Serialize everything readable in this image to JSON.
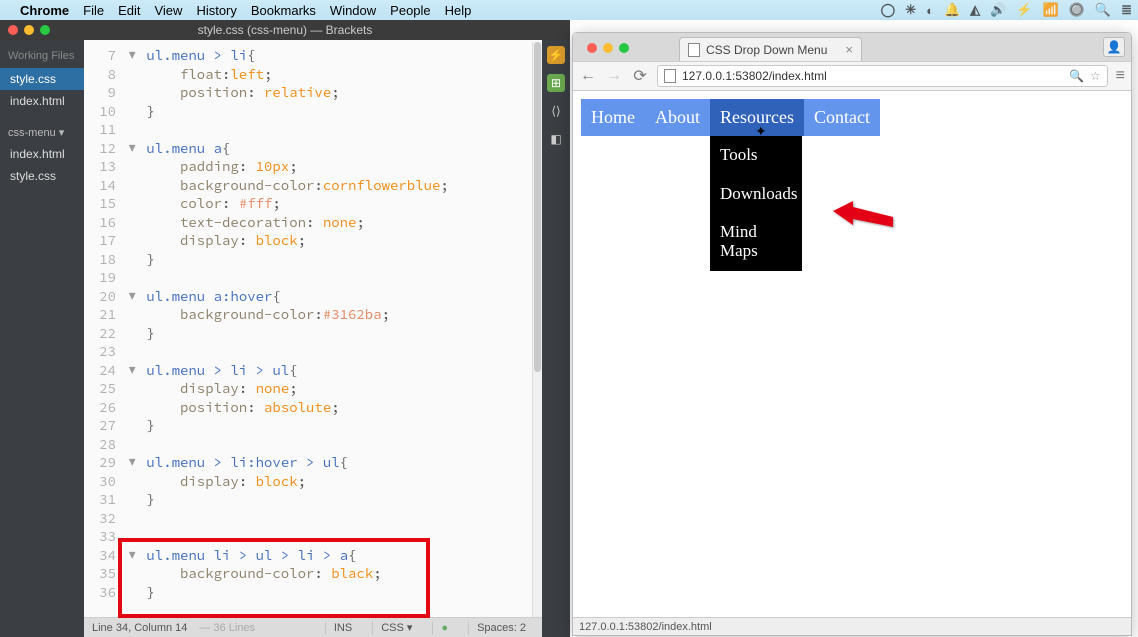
{
  "mac_menu": {
    "apple": "",
    "app": "Chrome",
    "items": [
      "File",
      "Edit",
      "View",
      "History",
      "Bookmarks",
      "Window",
      "People",
      "Help"
    ],
    "right_icons": [
      "◯",
      "✳",
      "◐",
      "🔔",
      "◭",
      "🔊",
      "⚡",
      "📶",
      "🔘",
      "🔍",
      "≣"
    ]
  },
  "brackets": {
    "title": "style.css (css-menu) — Brackets",
    "sidebar": {
      "working_heading": "Working Files",
      "working": [
        {
          "name": "style.css",
          "active": true
        },
        {
          "name": "index.html",
          "active": false
        }
      ],
      "project_name": "css-menu ▾",
      "project_files": [
        "index.html",
        "style.css"
      ]
    },
    "code_lines": [
      {
        "n": 7,
        "fold": "▼",
        "text_html": "<span class='sel'>ul.menu</span> <span class='sel'>&gt;</span> <span class='sel'>li</span><span class='brace'>{</span>"
      },
      {
        "n": 8,
        "fold": "",
        "text_html": "    <span class='prop'>float</span><span class='punc'>:</span><span class='valkw'>left</span><span class='punc'>;</span>"
      },
      {
        "n": 9,
        "fold": "",
        "text_html": "    <span class='prop'>position</span><span class='punc'>:</span> <span class='valkw'>relative</span><span class='punc'>;</span>"
      },
      {
        "n": 10,
        "fold": "",
        "text_html": "<span class='brace'>}</span>"
      },
      {
        "n": 11,
        "fold": "",
        "text_html": ""
      },
      {
        "n": 12,
        "fold": "▼",
        "text_html": "<span class='sel'>ul.menu</span> <span class='sel'>a</span><span class='brace'>{</span>"
      },
      {
        "n": 13,
        "fold": "",
        "text_html": "    <span class='prop'>padding</span><span class='punc'>:</span> <span class='valkw'>10px</span><span class='punc'>;</span>"
      },
      {
        "n": 14,
        "fold": "",
        "text_html": "    <span class='prop'>background-color</span><span class='punc'>:</span><span class='valkw'>cornflowerblue</span><span class='punc'>;</span>"
      },
      {
        "n": 15,
        "fold": "",
        "text_html": "    <span class='prop'>color</span><span class='punc'>:</span> <span class='val'>#fff</span><span class='punc'>;</span>"
      },
      {
        "n": 16,
        "fold": "",
        "text_html": "    <span class='prop'>text-decoration</span><span class='punc'>:</span> <span class='valkw'>none</span><span class='punc'>;</span>"
      },
      {
        "n": 17,
        "fold": "",
        "text_html": "    <span class='prop'>display</span><span class='punc'>:</span> <span class='valkw'>block</span><span class='punc'>;</span>"
      },
      {
        "n": 18,
        "fold": "",
        "text_html": "<span class='brace'>}</span>"
      },
      {
        "n": 19,
        "fold": "",
        "text_html": ""
      },
      {
        "n": 20,
        "fold": "▼",
        "text_html": "<span class='sel'>ul.menu</span> <span class='sel'>a:hover</span><span class='brace'>{</span>"
      },
      {
        "n": 21,
        "fold": "",
        "text_html": "    <span class='prop'>background-color</span><span class='punc'>:</span><span class='val'>#3162ba</span><span class='punc'>;</span>"
      },
      {
        "n": 22,
        "fold": "",
        "text_html": "<span class='brace'>}</span>"
      },
      {
        "n": 23,
        "fold": "",
        "text_html": ""
      },
      {
        "n": 24,
        "fold": "▼",
        "text_html": "<span class='sel'>ul.menu</span> <span class='sel'>&gt;</span> <span class='sel'>li</span> <span class='sel'>&gt;</span> <span class='sel'>ul</span><span class='brace'>{</span>"
      },
      {
        "n": 25,
        "fold": "",
        "text_html": "    <span class='prop'>display</span><span class='punc'>:</span> <span class='valkw'>none</span><span class='punc'>;</span>"
      },
      {
        "n": 26,
        "fold": "",
        "text_html": "    <span class='prop'>position</span><span class='punc'>:</span> <span class='valkw'>absolute</span><span class='punc'>;</span>"
      },
      {
        "n": 27,
        "fold": "",
        "text_html": "<span class='brace'>}</span>"
      },
      {
        "n": 28,
        "fold": "",
        "text_html": ""
      },
      {
        "n": 29,
        "fold": "▼",
        "text_html": "<span class='sel'>ul.menu</span> <span class='sel'>&gt;</span> <span class='sel'>li:hover</span> <span class='sel'>&gt;</span> <span class='sel'>ul</span><span class='brace'>{</span>"
      },
      {
        "n": 30,
        "fold": "",
        "text_html": "    <span class='prop'>display</span><span class='punc'>:</span> <span class='valkw'>block</span><span class='punc'>;</span>"
      },
      {
        "n": 31,
        "fold": "",
        "text_html": "<span class='brace'>}</span>"
      },
      {
        "n": 32,
        "fold": "",
        "text_html": ""
      },
      {
        "n": 33,
        "fold": "",
        "text_html": ""
      },
      {
        "n": 34,
        "fold": "▼",
        "text_html": "<span class='sel'>ul.menu</span> <span class='sel'>li</span> <span class='sel'>&gt;</span> <span class='sel'>ul</span> <span class='sel'>&gt;</span> <span class='sel'>li</span> <span class='sel'>&gt;</span> <span class='sel'>a</span><span class='brace'>{</span>"
      },
      {
        "n": 35,
        "fold": "",
        "text_html": "    <span class='prop'>background-color</span><span class='punc'>:</span> <span class='valkw'>black</span><span class='punc'>;</span>"
      },
      {
        "n": 36,
        "fold": "",
        "text_html": "<span class='brace'>}</span>"
      }
    ],
    "status": {
      "cursor": "Line 34, Column 14",
      "total": "— 36 Lines",
      "ins": "INS",
      "lang": "CSS ▾",
      "lint": "●",
      "spaces": "Spaces: 2"
    }
  },
  "chrome": {
    "tab_title": "CSS Drop Down Menu",
    "url": "127.0.0.1:53802/index.html",
    "nav": {
      "back": "←",
      "forward": "→",
      "reload": "⟳"
    },
    "menu_items": [
      {
        "label": "Home",
        "submenu": []
      },
      {
        "label": "About",
        "submenu": []
      },
      {
        "label": "Resources",
        "hover": true,
        "submenu": [
          "Tools",
          "Downloads",
          "Mind Maps"
        ]
      },
      {
        "label": "Contact",
        "submenu": []
      }
    ],
    "status": "127.0.0.1:53802/index.html"
  }
}
